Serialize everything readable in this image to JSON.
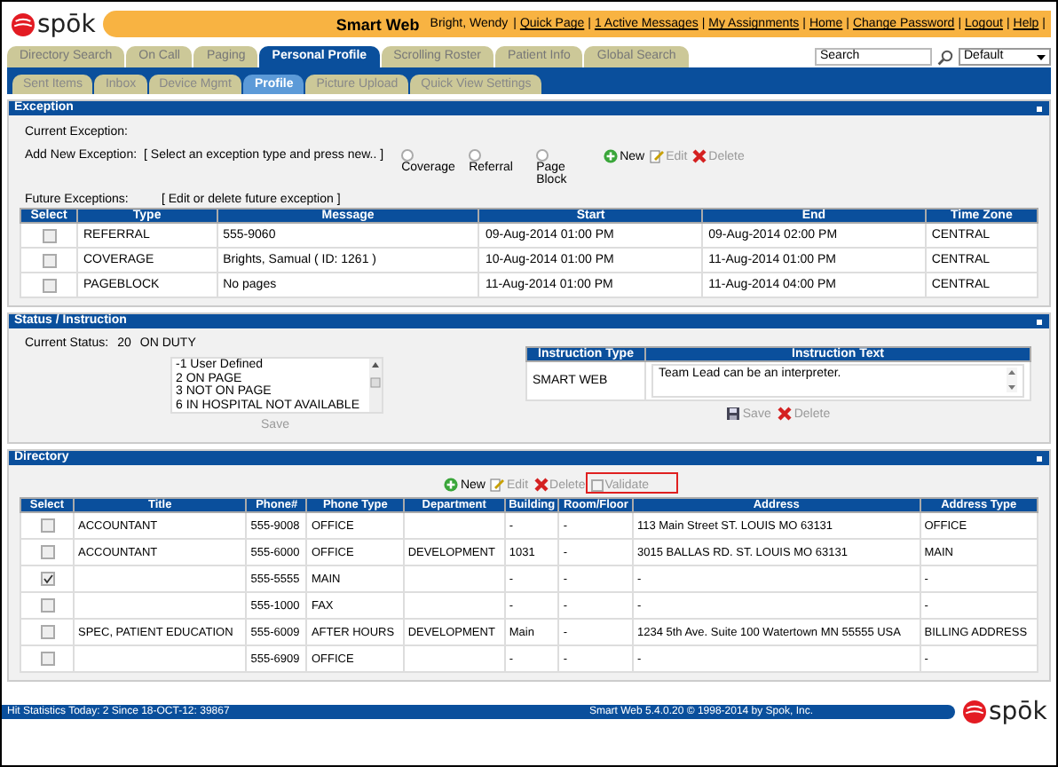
{
  "header": {
    "logo": "spōk",
    "app_title": "Smart Web",
    "user": "Bright, Wendy",
    "separator": "|",
    "links": [
      "Quick Page",
      "1 Active Messages",
      "My Assignments",
      "Home",
      "Change Password",
      "Logout",
      "Help"
    ]
  },
  "tabs": [
    {
      "label": "Directory Search",
      "selected": false
    },
    {
      "label": "On Call",
      "selected": false
    },
    {
      "label": "Paging",
      "selected": false
    },
    {
      "label": "Personal Profile",
      "selected": true
    },
    {
      "label": "Scrolling Roster",
      "selected": false
    },
    {
      "label": "Patient Info",
      "selected": false
    },
    {
      "label": "Global Search",
      "selected": false
    }
  ],
  "search": {
    "value": "Search"
  },
  "view_select": {
    "value": "Default"
  },
  "subtabs": [
    {
      "label": "Sent Items",
      "selected": false
    },
    {
      "label": "Inbox",
      "selected": false
    },
    {
      "label": "Device Mgmt",
      "selected": false
    },
    {
      "label": "Profile",
      "selected": true
    },
    {
      "label": "Picture Upload",
      "selected": false
    },
    {
      "label": "Quick View Settings",
      "selected": false
    }
  ],
  "exception": {
    "title": "Exception",
    "current_label": "Current Exception:",
    "add_label": "Add New Exception:",
    "add_hint": "[ Select an exception type and press new.. ]",
    "types": [
      {
        "label": "Coverage",
        "selected": false
      },
      {
        "label": "Referral",
        "selected": false
      },
      {
        "label": "Page Block",
        "selected": false
      }
    ],
    "actions": [
      {
        "kind": "new",
        "label": "New",
        "disabled": false
      },
      {
        "kind": "edit",
        "label": "Edit",
        "disabled": true
      },
      {
        "kind": "delete",
        "label": "Delete",
        "disabled": true
      }
    ],
    "future_label": "Future Exceptions:",
    "future_hint": "[ Edit or delete future exception ]",
    "select_header": "Select",
    "columns": [
      "Type",
      "Message",
      "Start",
      "End",
      "Time Zone"
    ],
    "rows": [
      {
        "checked": false,
        "cells": [
          "REFERRAL",
          "555-9060",
          "09-Aug-2014 01:00 PM",
          "09-Aug-2014 02:00 PM",
          "CENTRAL"
        ]
      },
      {
        "checked": false,
        "cells": [
          "COVERAGE",
          "Brights, Samual ( ID: 1261 )",
          "10-Aug-2014 01:00 PM",
          "11-Aug-2014 01:00 PM",
          "CENTRAL"
        ]
      },
      {
        "checked": false,
        "cells": [
          "PAGEBLOCK",
          "No pages",
          "11-Aug-2014 01:00 PM",
          "11-Aug-2014 04:00 PM",
          "CENTRAL"
        ]
      }
    ]
  },
  "status": {
    "title": "Status / Instruction",
    "current_label": "Current Status:",
    "current_code": "20",
    "current_value": "ON DUTY",
    "options": [
      "-1 User Defined",
      "2 ON PAGE",
      "3 NOT ON PAGE",
      "6 IN HOSPITAL NOT AVAILABLE"
    ],
    "save": {
      "label": "Save",
      "disabled": true
    },
    "instruction_columns": [
      "Instruction Type",
      "Instruction Text"
    ],
    "instruction": {
      "type": "SMART WEB",
      "text": "Team Lead can be an interpreter."
    },
    "instruction_actions": [
      {
        "kind": "save",
        "label": "Save",
        "disabled": true
      },
      {
        "kind": "delete",
        "label": "Delete",
        "disabled": true
      }
    ]
  },
  "directory": {
    "title": "Directory",
    "actions": [
      {
        "kind": "new",
        "label": "New",
        "disabled": false
      },
      {
        "kind": "edit",
        "label": "Edit",
        "disabled": true
      },
      {
        "kind": "delete",
        "label": "Delete",
        "disabled": true
      },
      {
        "kind": "validate",
        "label": "Validate",
        "disabled": true
      }
    ],
    "select_header": "Select",
    "columns": [
      "Title",
      "Phone#",
      "Phone Type",
      "Department",
      "Building",
      "Room/Floor",
      "Address",
      "Address Type"
    ],
    "rows": [
      {
        "checked": false,
        "cells": [
          "ACCOUNTANT",
          "555-9008",
          "OFFICE",
          "",
          "-",
          "-",
          "113 Main Street ST. LOUIS MO 63131",
          "OFFICE"
        ]
      },
      {
        "checked": false,
        "cells": [
          "ACCOUNTANT",
          "555-6000",
          "OFFICE",
          "DEVELOPMENT",
          "1031",
          "-",
          "3015 BALLAS RD. ST. LOUIS MO 63131",
          "MAIN"
        ]
      },
      {
        "checked": true,
        "cells": [
          "",
          "555-5555",
          "MAIN",
          "",
          "-",
          "-",
          "-",
          "-"
        ]
      },
      {
        "checked": false,
        "cells": [
          "",
          "555-1000",
          "FAX",
          "",
          "-",
          "-",
          "-",
          "-"
        ]
      },
      {
        "checked": false,
        "cells": [
          "SPEC, PATIENT EDUCATION",
          "555-6009",
          "AFTER HOURS",
          "DEVELOPMENT",
          "Main",
          "-",
          "1234 5th Ave. Suite 100 Watertown MN 55555 USA",
          "BILLING ADDRESS"
        ]
      },
      {
        "checked": false,
        "cells": [
          "",
          "555-6909",
          "OFFICE",
          "",
          "-",
          "-",
          "-",
          "-"
        ]
      }
    ]
  },
  "footer": {
    "stats": "Hit Statistics Today: 2 Since 18-OCT-12: 39867",
    "copyright": "Smart Web 5.4.0.20 © 1998-2014 by Spok, Inc.",
    "logo": "spōk"
  }
}
